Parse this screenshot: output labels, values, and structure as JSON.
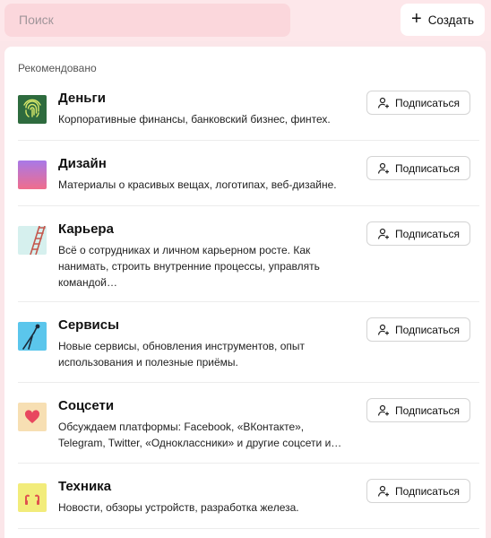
{
  "search": {
    "placeholder": "Поиск"
  },
  "create_button": {
    "label": "Создать",
    "icon": "plus-icon"
  },
  "section_title": "Рекомендовано",
  "subscribe_label": "Подписаться",
  "items": [
    {
      "name": "Деньги",
      "description": "Корпоративные финансы, банковский бизнес, финтех.",
      "icon": "fingerprint-icon",
      "color": "#2e6b3e"
    },
    {
      "name": "Дизайн",
      "description": "Материалы о красивых вещах, логотипах, веб-дизайне.",
      "icon": "gradient-icon",
      "color": "#a879e8"
    },
    {
      "name": "Карьера",
      "description": "Всё о сотрудниках и личном карьерном росте. Как нанимать, строить внутренние процессы, управлять командой…",
      "icon": "ladder-icon",
      "color": "#d6f0ee"
    },
    {
      "name": "Сервисы",
      "description": "Новые сервисы, обновления инструментов, опыт использования и полезные приёмы.",
      "icon": "tools-icon",
      "color": "#5bc6ec"
    },
    {
      "name": "Соцсети",
      "description": "Обсуждаем платформы: Facebook, «ВКонтакте», Telegram, Twitter, «Одноклассники» и другие соцсети и…",
      "icon": "heart-icon",
      "color": "#f7dfb3"
    },
    {
      "name": "Техника",
      "description": "Новости, обзоры устройств, разработка железа.",
      "icon": "headphones-icon",
      "color": "#f2ec7b"
    }
  ]
}
